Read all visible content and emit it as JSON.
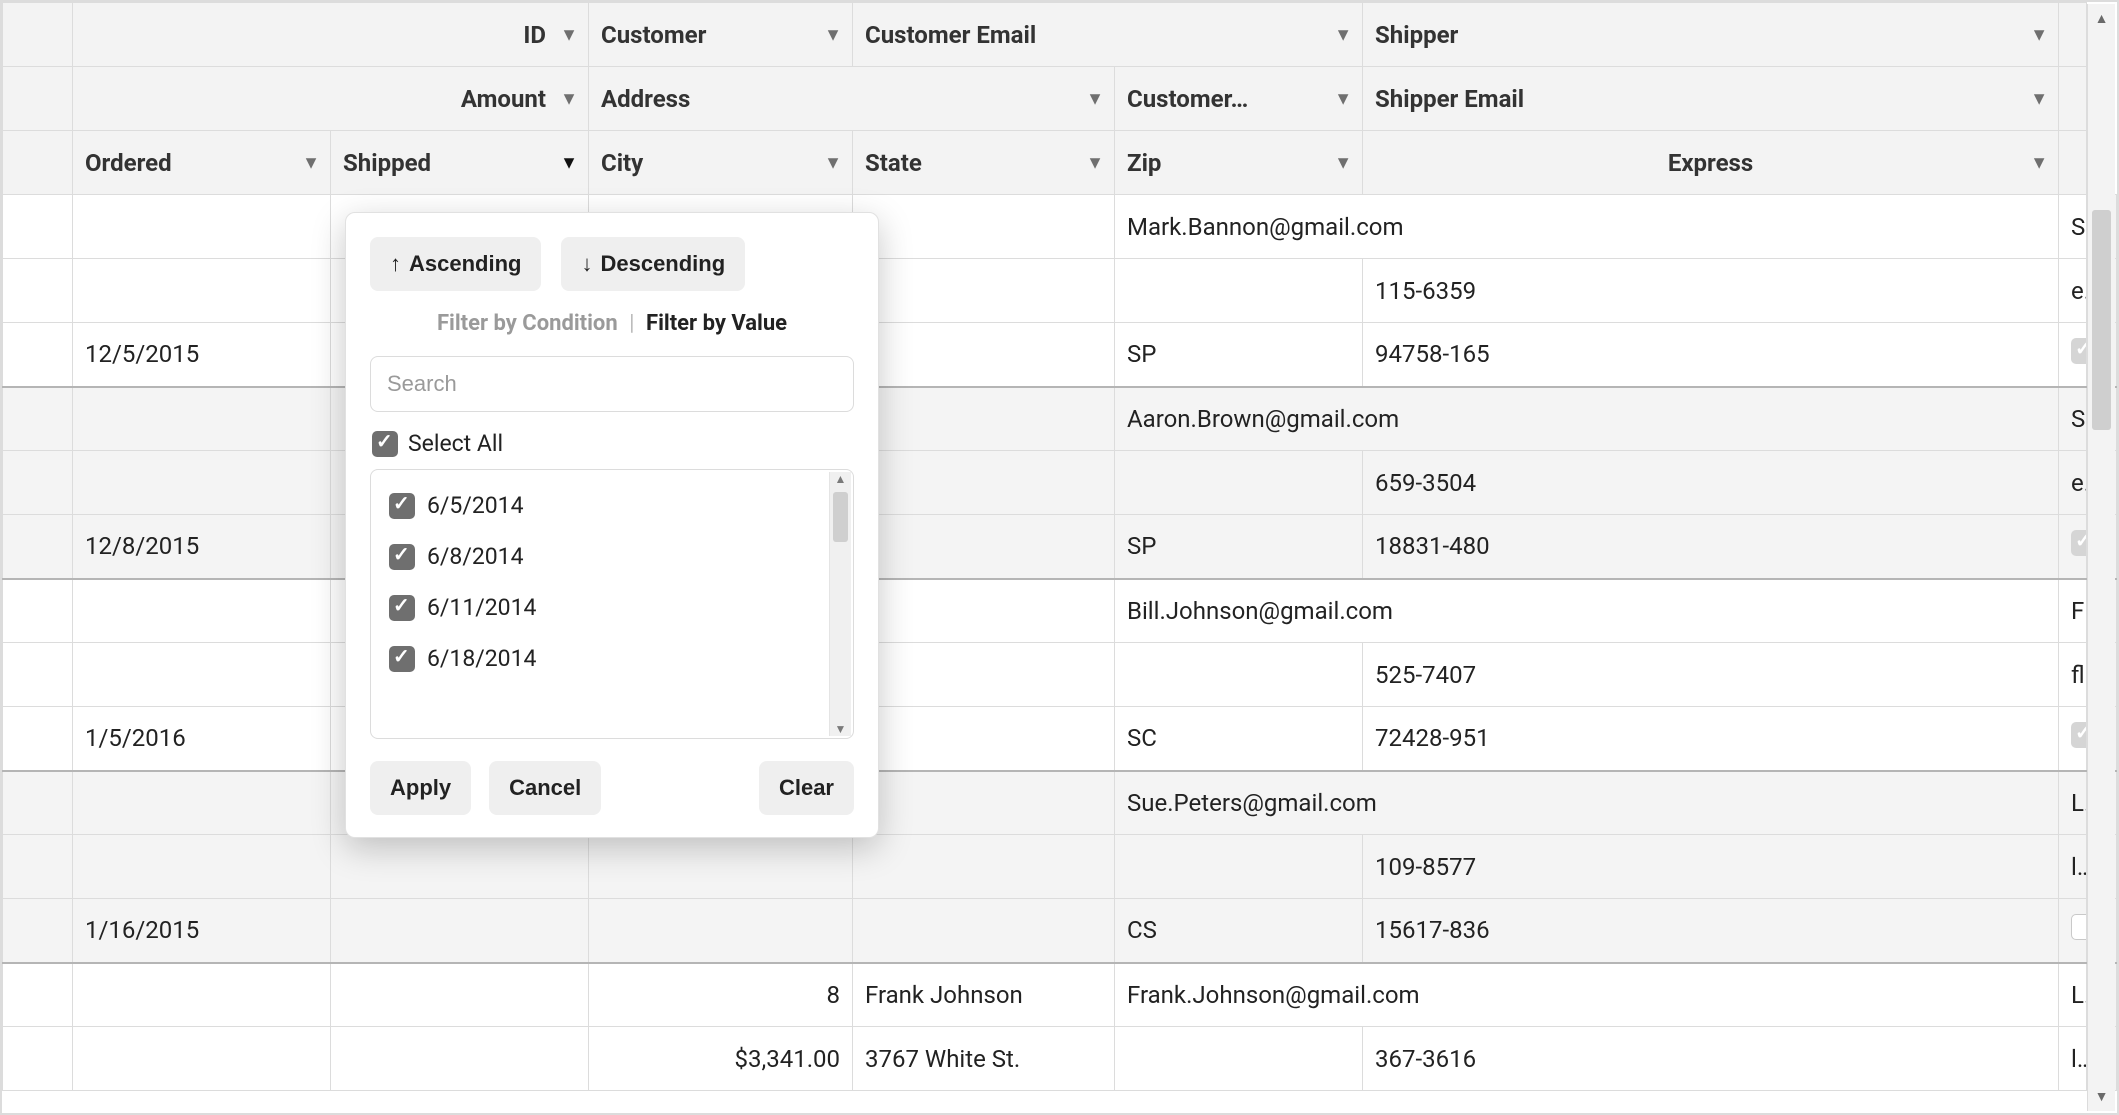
{
  "headers": {
    "row1": {
      "id": "ID",
      "customer": "Customer",
      "customer_email": "Customer Email",
      "shipper": "Shipper"
    },
    "row2": {
      "amount": "Amount",
      "address": "Address",
      "customer_trunc": "Customer…",
      "shipper_email": "Shipper Email"
    },
    "row3": {
      "ordered": "Ordered",
      "shipped": "Shipped",
      "city": "City",
      "state": "State",
      "zip": "Zip",
      "express": "Express"
    }
  },
  "rows": [
    {
      "alt": false,
      "sep": false,
      "cells": [
        "",
        "",
        "",
        "",
        "Mark.Bannon@gmail.com",
        "",
        "Speedy Express"
      ],
      "spans": [
        1,
        1,
        1,
        1,
        2,
        0,
        1
      ],
      "express": null
    },
    {
      "alt": false,
      "sep": false,
      "cells": [
        "",
        "",
        "",
        "",
        "",
        "115-6359",
        "express.speedy@gmail.com"
      ],
      "spans": [
        1,
        1,
        1,
        1,
        1,
        1,
        1
      ],
      "express": null
    },
    {
      "alt": false,
      "sep": false,
      "cells": [
        "12/5/2015",
        "",
        "",
        "",
        "SP",
        "94758-165",
        ""
      ],
      "spans": [
        1,
        1,
        1,
        1,
        1,
        1,
        1
      ],
      "express": "on"
    },
    {
      "alt": true,
      "sep": true,
      "cells": [
        "",
        "",
        "",
        "",
        "Aaron.Brown@gmail.com",
        "",
        "Speedy Express"
      ],
      "spans": [
        1,
        1,
        1,
        1,
        2,
        0,
        1
      ],
      "express": null
    },
    {
      "alt": true,
      "sep": false,
      "cells": [
        "",
        "",
        "",
        "",
        "",
        "659-3504",
        "express.speedy@gmail.com"
      ],
      "spans": [
        1,
        1,
        1,
        1,
        1,
        1,
        1
      ],
      "express": null
    },
    {
      "alt": true,
      "sep": false,
      "cells": [
        "12/8/2015",
        "",
        "",
        "",
        "SP",
        "18831-480",
        ""
      ],
      "spans": [
        1,
        1,
        1,
        1,
        1,
        1,
        1
      ],
      "express": "on"
    },
    {
      "alt": false,
      "sep": true,
      "cells": [
        "",
        "",
        "",
        "",
        "Bill.Johnson@gmail.com",
        "",
        "Flash Delivery"
      ],
      "spans": [
        1,
        1,
        1,
        1,
        2,
        0,
        1
      ],
      "express": null
    },
    {
      "alt": false,
      "sep": false,
      "cells": [
        "",
        "",
        "",
        "",
        "",
        "525-7407",
        "flash@gmail.com"
      ],
      "spans": [
        1,
        1,
        1,
        1,
        1,
        1,
        1
      ],
      "express": null
    },
    {
      "alt": false,
      "sep": false,
      "cells": [
        "1/5/2016",
        "",
        "",
        "",
        "SC",
        "72428-951",
        ""
      ],
      "spans": [
        1,
        1,
        1,
        1,
        1,
        1,
        1
      ],
      "express": "on"
    },
    {
      "alt": true,
      "sep": true,
      "cells": [
        "",
        "",
        "",
        "",
        "Sue.Peters@gmail.com",
        "",
        "Logitrax"
      ],
      "spans": [
        1,
        1,
        1,
        1,
        2,
        0,
        1
      ],
      "express": null
    },
    {
      "alt": true,
      "sep": false,
      "cells": [
        "",
        "",
        "",
        "",
        "",
        "109-8577",
        "logitrax@gmail.com"
      ],
      "spans": [
        1,
        1,
        1,
        1,
        1,
        1,
        1
      ],
      "express": null
    },
    {
      "alt": true,
      "sep": false,
      "cells": [
        "1/16/2015",
        "",
        "",
        "",
        "CS",
        "15617-836",
        ""
      ],
      "spans": [
        1,
        1,
        1,
        1,
        1,
        1,
        1
      ],
      "express": "hollow"
    },
    {
      "alt": false,
      "sep": true,
      "cells": [
        "",
        "",
        "8",
        "Frank Johnson",
        "Frank.Johnson@gmail.com",
        "",
        "Logitrax"
      ],
      "spans": [
        1,
        1,
        1,
        1,
        2,
        0,
        1
      ],
      "express": null,
      "id_right": true
    },
    {
      "alt": false,
      "sep": false,
      "cells": [
        "",
        "",
        "$3,341.00",
        "3767 White St.",
        "",
        "367-3616",
        "logitrax@gmail.com"
      ],
      "spans": [
        1,
        1,
        1,
        1,
        1,
        1,
        1
      ],
      "express": null,
      "amt_right": true
    }
  ],
  "popup": {
    "ascending": "Ascending",
    "descending": "Descending",
    "tab_condition": "Filter by Condition",
    "tab_value": "Filter by Value",
    "search_placeholder": "Search",
    "select_all": "Select All",
    "values": [
      "6/5/2014",
      "6/8/2014",
      "6/11/2014",
      "6/18/2014"
    ],
    "apply": "Apply",
    "cancel": "Cancel",
    "clear": "Clear"
  }
}
